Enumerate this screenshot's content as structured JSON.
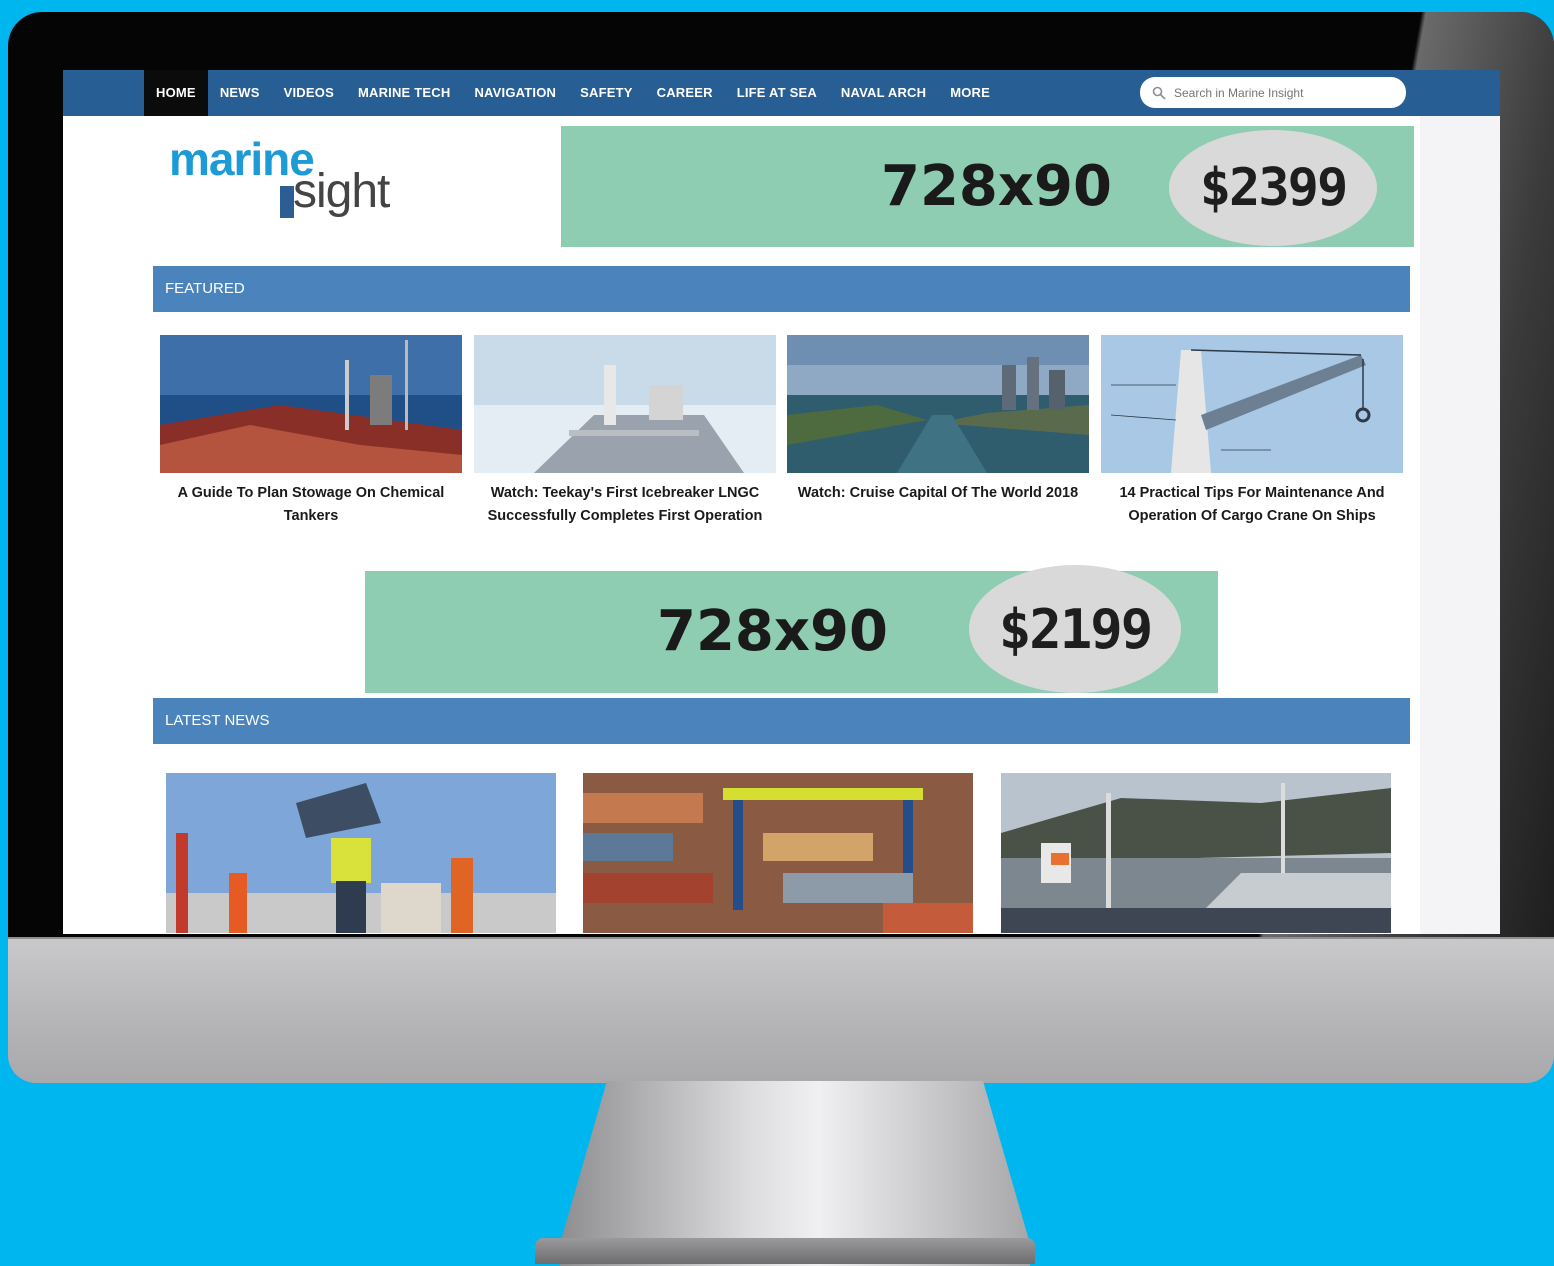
{
  "nav": {
    "items": [
      {
        "label": "HOME",
        "active": true
      },
      {
        "label": "NEWS"
      },
      {
        "label": "VIDEOS"
      },
      {
        "label": "MARINE TECH"
      },
      {
        "label": "NAVIGATION"
      },
      {
        "label": "SAFETY"
      },
      {
        "label": "CAREER"
      },
      {
        "label": "LIFE AT SEA"
      },
      {
        "label": "NAVAL ARCH"
      },
      {
        "label": "MORE"
      }
    ],
    "search_placeholder": "Search in Marine Insight"
  },
  "logo": {
    "part1": "marine",
    "part2": "sight"
  },
  "ads": {
    "top": {
      "size": "728x90",
      "price": "$2399"
    },
    "middle": {
      "size": "728x90",
      "price": "$2199"
    }
  },
  "sections": {
    "featured": "FEATURED",
    "latest": "LATEST NEWS"
  },
  "featured": [
    {
      "caption": "A Guide To Plan Stowage On Chemical Tankers"
    },
    {
      "caption": "Watch: Teekay's First Icebreaker LNGC Successfully Completes First Operation"
    },
    {
      "caption": "Watch: Cruise Capital Of The World 2018"
    },
    {
      "caption": "14 Practical Tips For Maintenance And Operation Of Cargo Crane On Ships"
    }
  ],
  "colors": {
    "background": "#00b6ef",
    "nav": "#275e93",
    "section_bar": "#4b83bd",
    "ad_fill": "#8ecdb1",
    "price_badge": "#d9d9d9"
  }
}
